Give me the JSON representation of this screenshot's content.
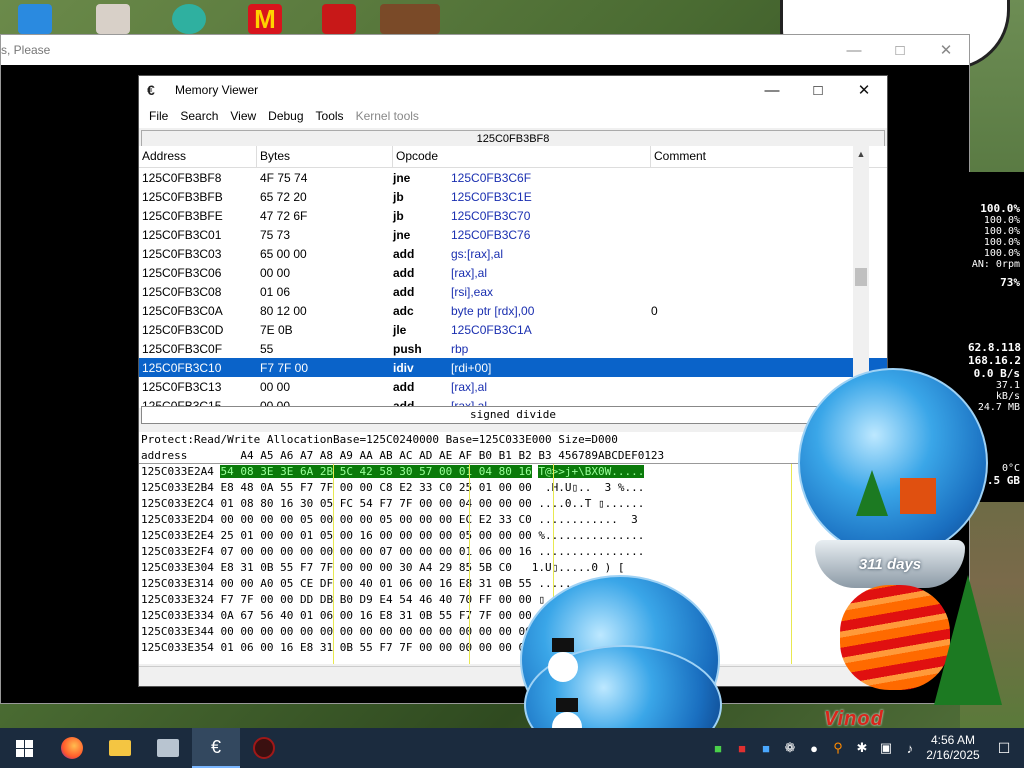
{
  "background_window": {
    "title": "s, Please"
  },
  "side_panel": {
    "lines": [
      "100.0%",
      "100.0%",
      "100.0%",
      "100.0%",
      "100.0%",
      "AN: 0rpm",
      "73%",
      "62.8.118",
      "168.16.2",
      "0.0 B/s",
      "37.1 kB/s",
      "24.7 MB",
      "0°C",
      "9.5 GB"
    ]
  },
  "memory_viewer": {
    "title": "Memory Viewer",
    "menu": [
      "File",
      "Search",
      "View",
      "Debug",
      "Tools",
      "Kernel tools"
    ],
    "address_bar": "125C0FB3BF8",
    "disasm_headers": {
      "address": "Address",
      "bytes": "Bytes",
      "opcode": "Opcode",
      "comment": "Comment"
    },
    "status": "signed divide",
    "hex_info": "Protect:Read/Write  AllocationBase=125C0240000 Base=125C033E000 Size=D000",
    "hex_header": "address        A4 A5 A6 A7 A8 A9 AA AB AC AD AE AF B0 B1 B2 B3 456789ABCDEF0123"
  },
  "disasm_rows": [
    {
      "address": "125C0FB3BF8",
      "bytes": "4F 75 74",
      "mnemonic": "jne",
      "operand": "125C0FB3C6F",
      "comment": ""
    },
    {
      "address": "125C0FB3BFB",
      "bytes": "65 72 20",
      "mnemonic": "jb",
      "operand": "125C0FB3C1E",
      "comment": ""
    },
    {
      "address": "125C0FB3BFE",
      "bytes": "47 72 6F",
      "mnemonic": "jb",
      "operand": "125C0FB3C70",
      "comment": ""
    },
    {
      "address": "125C0FB3C01",
      "bytes": "75 73",
      "mnemonic": "jne",
      "operand": "125C0FB3C76",
      "comment": ""
    },
    {
      "address": "125C0FB3C03",
      "bytes": "65 00 00",
      "mnemonic": "add",
      "operand": "gs:[rax],al",
      "comment": ""
    },
    {
      "address": "125C0FB3C06",
      "bytes": "00 00",
      "mnemonic": "add",
      "operand": "[rax],al",
      "comment": ""
    },
    {
      "address": "125C0FB3C08",
      "bytes": "01 06",
      "mnemonic": "add",
      "operand": "[rsi],eax",
      "comment": ""
    },
    {
      "address": "125C0FB3C0A",
      "bytes": "80 12 00",
      "mnemonic": "adc",
      "operand": "byte ptr [rdx],00",
      "comment": "0"
    },
    {
      "address": "125C0FB3C0D",
      "bytes": "7E 0B",
      "mnemonic": "jle",
      "operand": "125C0FB3C1A",
      "comment": ""
    },
    {
      "address": "125C0FB3C0F",
      "bytes": "55",
      "mnemonic": "push",
      "operand": "rbp",
      "comment": ""
    },
    {
      "address": "125C0FB3C10",
      "bytes": "F7 7F 00",
      "mnemonic": "idiv",
      "operand": "[rdi+00]",
      "comment": "",
      "selected": true
    },
    {
      "address": "125C0FB3C13",
      "bytes": "00 00",
      "mnemonic": "add",
      "operand": "[rax],al",
      "comment": ""
    },
    {
      "address": "125C0FB3C15",
      "bytes": "00 00",
      "mnemonic": "add",
      "operand": "[rax],al",
      "comment": ""
    }
  ],
  "hex_rows": [
    {
      "address": "125C033E2A4",
      "bytes": "54 08 3E 3E 6A 2B 5C 42 58 30 57 00 01 04 80 16",
      "ascii": "T@>>j+\\BX0W....."
    },
    {
      "address": "125C033E2B4",
      "bytes": "E8 48 0A 55 F7 7F 00 00 C8 E2 33 C0 25 01 00 00",
      "ascii": " .H.U▯..  3 %..."
    },
    {
      "address": "125C033E2C4",
      "bytes": "01 08 80 16 30 05 FC 54 F7 7F 00 00 04 00 00 00",
      "ascii": "....0..T ▯......"
    },
    {
      "address": "125C033E2D4",
      "bytes": "00 00 00 00 05 00 00 00 05 00 00 00 EC E2 33 C0",
      "ascii": "............  3 "
    },
    {
      "address": "125C033E2E4",
      "bytes": "25 01 00 00 01 05 00 16 00 00 00 00 05 00 00 00",
      "ascii": "%..............."
    },
    {
      "address": "125C033E2F4",
      "bytes": "07 00 00 00 00 00 00 00 07 00 00 00 01 06 00 16",
      "ascii": "................"
    },
    {
      "address": "125C033E304",
      "bytes": "E8 31 0B 55 F7 7F 00 00 00 30 A4 29 85 5B C0 ",
      "ascii": " 1.U▯.....0 ) [ "
    },
    {
      "address": "125C033E314",
      "bytes": "00 00 A0 05 CE DF 00 40 01 06 00 16 E8 31 0B 55",
      "ascii": "........@.... 1.U"
    },
    {
      "address": "125C033E324",
      "bytes": "F7 7F 00 00 DD DB B0 D9 E4 54 46 40 70 FF 00 00",
      "ascii": "▯.......TF@p I  "
    },
    {
      "address": "125C033E334",
      "bytes": "0A 67 56 40 01 06 00 16 E8 31 0B 55 F7 7F 00 00",
      "ascii": ".gV@.... 1.U ▯.."
    },
    {
      "address": "125C033E344",
      "bytes": "00 00 00 00 00 00 00 00 00 00 00 00 00 00 00 00",
      "ascii": "................"
    },
    {
      "address": "125C033E354",
      "bytes": "01 06 00 16 E8 31 0B 55 F7 7F 00 00 00 00 00 00",
      "ascii": "... 1.U▯...XRMy"
    }
  ],
  "globe": {
    "label": "311 days"
  },
  "banner": "Vinod",
  "taskbar": {
    "time": "4:56 AM",
    "date": "2/16/2025"
  }
}
